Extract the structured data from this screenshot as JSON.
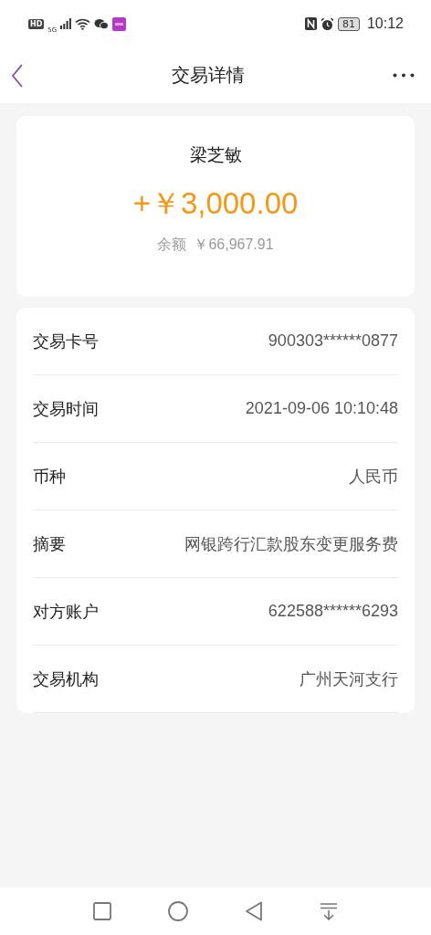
{
  "status_bar": {
    "hd": "HD",
    "network": "5G",
    "battery": "81",
    "time": "10:12"
  },
  "header": {
    "title": "交易详情"
  },
  "summary": {
    "name": "梁芝敏",
    "amount": "+￥3,000.00",
    "balance_label": "余额",
    "balance": "￥66,967.91"
  },
  "details": [
    {
      "label": "交易卡号",
      "value": "900303******0877"
    },
    {
      "label": "交易时间",
      "value": "2021-09-06 10:10:48"
    },
    {
      "label": "币种",
      "value": "人民币"
    },
    {
      "label": "摘要",
      "value": "网银跨行汇款股东变更服务费"
    },
    {
      "label": "对方账户",
      "value": "622588******6293"
    },
    {
      "label": "交易机构",
      "value": "广州天河支行"
    }
  ]
}
